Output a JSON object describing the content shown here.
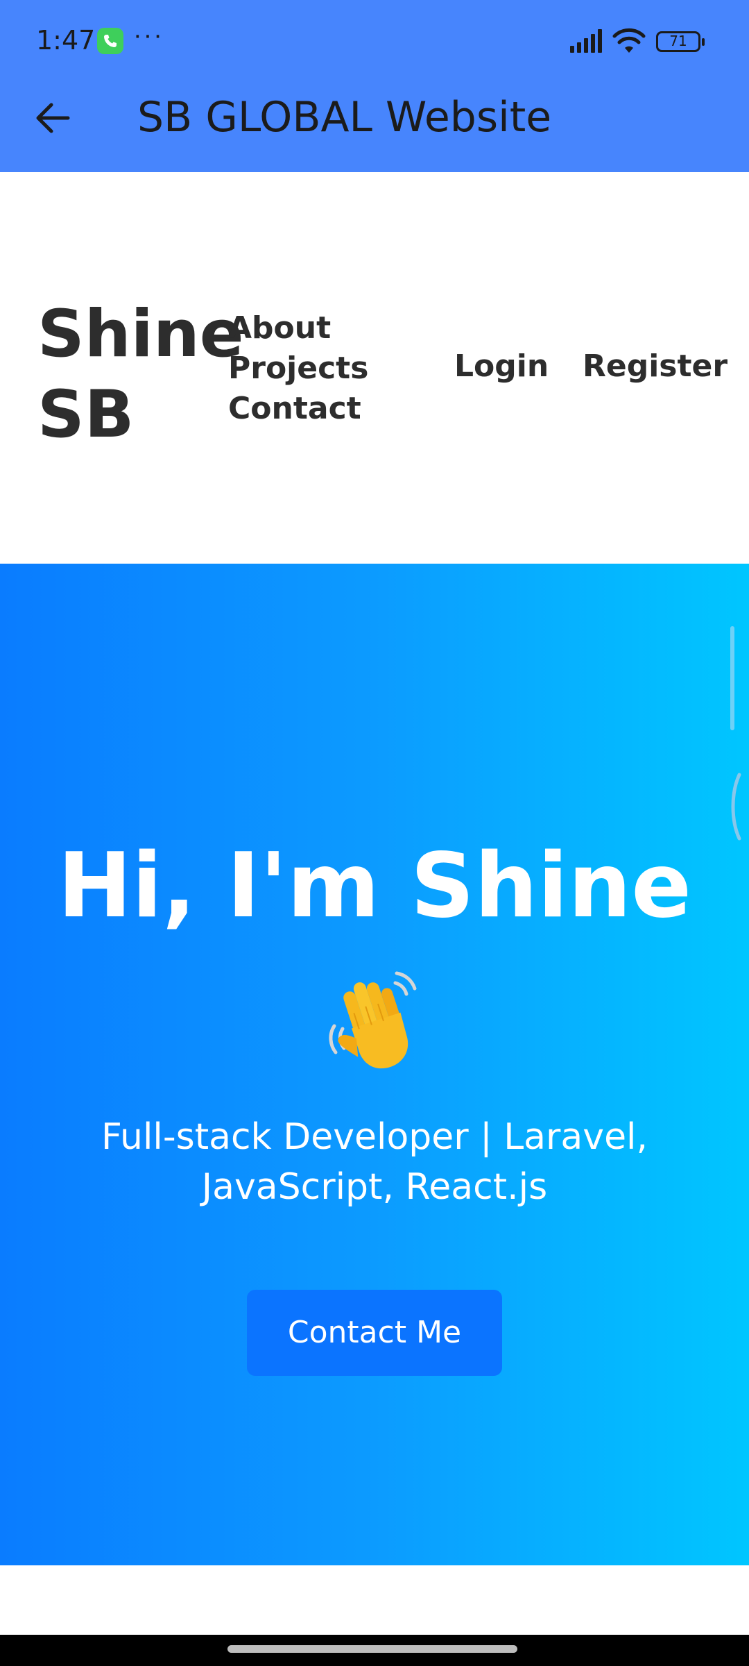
{
  "status_bar": {
    "time": "1:47",
    "dots": "···",
    "battery": "71",
    "icons": [
      "phone-call-icon",
      "signal-icon",
      "wifi-icon",
      "battery-icon"
    ]
  },
  "app_bar": {
    "title": "SB GLOBAL Website",
    "back_icon": "arrow-left-icon"
  },
  "site_header": {
    "brand": "Shine SB",
    "nav": [
      "About",
      "Projects",
      "Contact"
    ],
    "login": "Login",
    "register": "Register"
  },
  "hero": {
    "title": "Hi, I'm Shine",
    "emoji": "👋",
    "subtitle": "Full-stack Developer | Laravel, JavaScript, React.js",
    "cta": "Contact Me"
  },
  "colors": {
    "app_bar": "#4785fd",
    "hero_start": "#0a7cff",
    "hero_end": "#00c6ff",
    "button": "#0b74ff",
    "text_dark": "#2d2d2d"
  }
}
